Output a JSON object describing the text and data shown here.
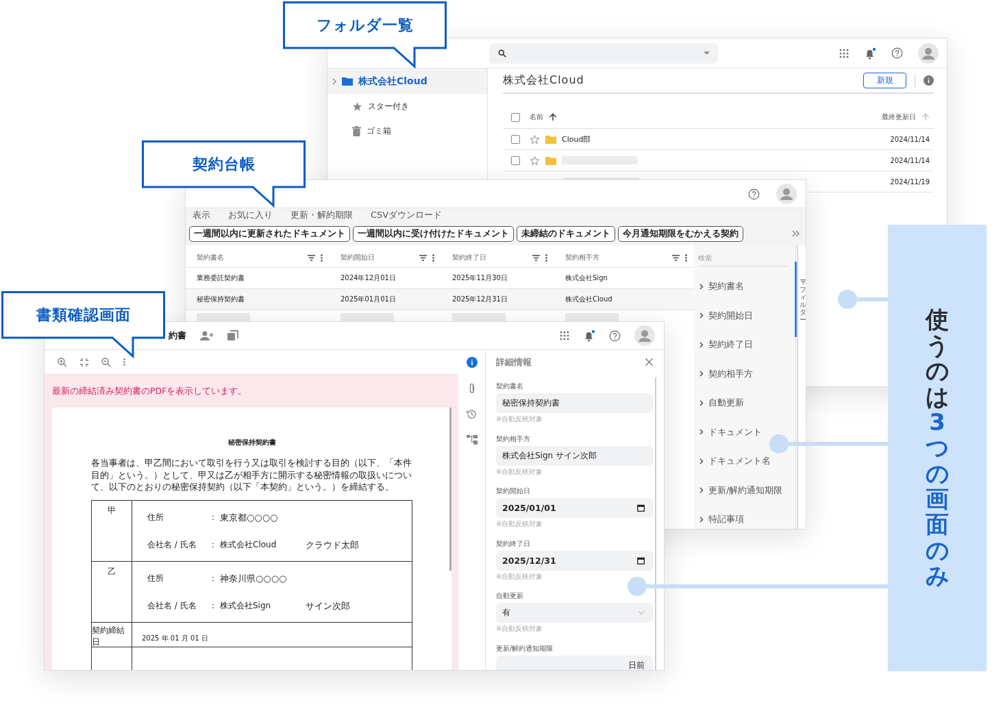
{
  "callouts": [
    {
      "label": "フォルダ一覧"
    },
    {
      "label": "契約台帳"
    },
    {
      "label": "書類確認画面"
    }
  ],
  "folder_window": {
    "sidebar": [
      {
        "label": "株式会社Cloud",
        "kind": "folder",
        "selected": true
      },
      {
        "label": "スター付き",
        "kind": "star",
        "selected": false
      },
      {
        "label": "ゴミ箱",
        "kind": "trash",
        "selected": false
      }
    ],
    "title": "株式会社Cloud",
    "new_button": "新規",
    "columns": [
      "名前",
      "最終更新日"
    ],
    "all_checked": false,
    "rows": [
      {
        "name": "Cloud部",
        "date": "2024/11/14",
        "checked": false,
        "starred": false
      },
      {
        "date": "2024/11/14",
        "checked": false,
        "starred": false
      },
      {
        "date": "2024/11/19"
      }
    ]
  },
  "ledger_window": {
    "menu": [
      "表示",
      "お気に入り",
      "更新・解約期限",
      "CSVダウンロード"
    ],
    "quick_filters": [
      "一週間以内に更新されたドキュメント",
      "一週間以内に受け付けたドキュメント",
      "未締結のドキュメント",
      "今月通知期限をむかえる契約"
    ],
    "columns": [
      "契約書名",
      "契約開始日",
      "契約終了日",
      "契約相手方"
    ],
    "rows": [
      {
        "kind": "data",
        "cells": [
          "業務委託契約書",
          "2024年12月01日",
          "2025年11月30日",
          "株式会社Sign"
        ]
      },
      {
        "kind": "data",
        "cells": [
          "秘密保持契約書",
          "2025年01月01日",
          "2025年12月31日",
          "株式会社Cloud"
        ]
      },
      {
        "kind": "placeholder"
      }
    ],
    "filter_panel": {
      "search_placeholder": "検索",
      "tab_label": "フィルター",
      "items": [
        "契約書名",
        "契約開始日",
        "契約終了日",
        "契約相手方",
        "自動更新",
        "ドキュメント",
        "ドキュメント名",
        "更新/解約通知期限",
        "特記事項"
      ]
    }
  },
  "document_window": {
    "title": "約書",
    "banner": "最新の締結済み契約書のPDFを表示しています。",
    "document": {
      "title": "秘密保持契約書",
      "intro": "各当事者は、甲乙間において取引を行う又は取引を検討する目的（以下、「本件目的」という。）として、甲又は乙が相手方に開示する秘密情報の取扱いについて、以下のとおりの秘密保持契約（以下「本契約」という。）を締結する。",
      "parties": [
        {
          "role": "甲",
          "address_label": "住所",
          "address_sep": "：",
          "address": "東京都○○○○",
          "name_label": "会社名 / 氏名",
          "name_sep": "：",
          "company": "株式会社Cloud",
          "person": "クラウド太郎"
        },
        {
          "role": "乙",
          "address_label": "住所",
          "address_sep": "：",
          "address": "神奈川県○○○○",
          "name_label": "会社名 / 氏名",
          "name_sep": "：",
          "company": "株式会社Sign",
          "person": "サイン次郎"
        }
      ],
      "signed_label": "契約締結日",
      "signed_date": "2025 年 01 月 01 日"
    },
    "rail": [
      {
        "kind": "info",
        "selected": true
      },
      {
        "kind": "clip",
        "selected": false
      },
      {
        "kind": "history",
        "selected": false
      },
      {
        "kind": "tree",
        "selected": false
      }
    ],
    "details": {
      "title": "詳細情報",
      "fields": [
        {
          "label": "契約書名",
          "kind": "text",
          "value": "秘密保持契約書",
          "note": "※自動反映対象"
        },
        {
          "label": "契約相手方",
          "kind": "text",
          "value": "株式会社Sign サイン次郎",
          "note": "※自動反映対象"
        },
        {
          "label": "契約開始日",
          "kind": "date",
          "value": "2025/01/01",
          "note": "※自動反映対象"
        },
        {
          "label": "契約終了日",
          "kind": "date",
          "value": "2025/12/31",
          "note": "※自動反映対象"
        },
        {
          "label": "自動更新",
          "kind": "select",
          "value": "有",
          "note": "※自動反映対象"
        },
        {
          "label": "更新/解約通知期限",
          "kind": "suffix",
          "suffix": "日前"
        }
      ]
    }
  },
  "aside": {
    "lead": "使うのは",
    "highlight": "3つの画面のみ"
  }
}
